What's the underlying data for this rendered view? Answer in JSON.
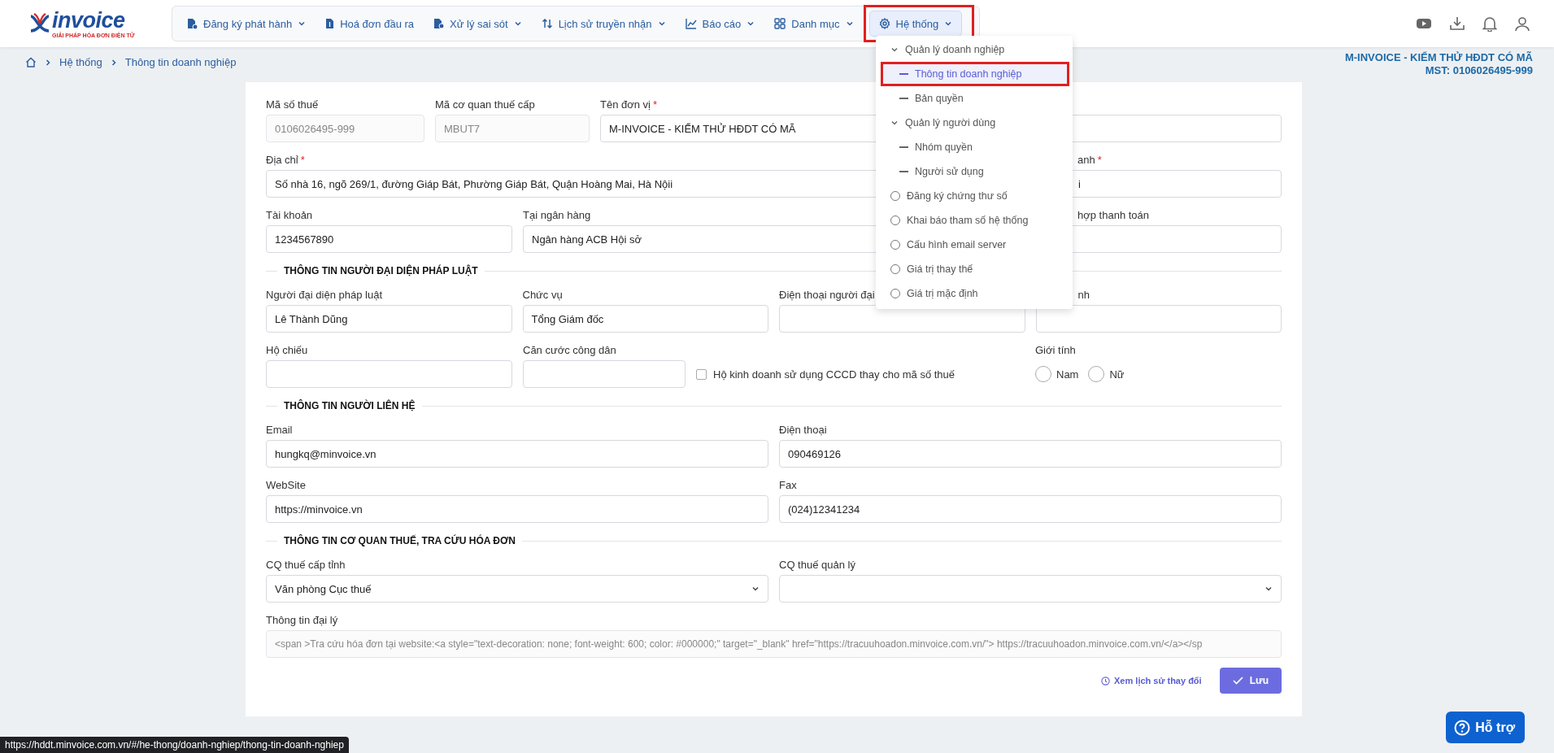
{
  "logo": {
    "text": "invoice",
    "tagline": "GIẢI PHÁP HÓA ĐƠN ĐIỆN TỬ"
  },
  "nav": {
    "items": [
      {
        "label": "Đăng ký phát hành",
        "caret": true,
        "selected": false,
        "outlined": false
      },
      {
        "label": "Hoá đơn đầu ra",
        "caret": false,
        "selected": false,
        "outlined": false
      },
      {
        "label": "Xử lý sai sót",
        "caret": true,
        "selected": false,
        "outlined": false
      },
      {
        "label": "Lịch sử truyền nhận",
        "caret": true,
        "selected": false,
        "outlined": false
      },
      {
        "label": "Báo cáo",
        "caret": true,
        "selected": false,
        "outlined": false
      },
      {
        "label": "Danh mục",
        "caret": true,
        "selected": false,
        "outlined": false
      },
      {
        "label": "Hệ thống",
        "caret": true,
        "selected": true,
        "outlined": true
      }
    ]
  },
  "breadcrumb": [
    "Hệ thống",
    "Thông tin doanh nghiệp"
  ],
  "company": {
    "name": "M-INVOICE - KIỂM THỬ HĐDT CÓ MÃ",
    "tax_code": "MST: 0106026495-999"
  },
  "system_menu": {
    "items": [
      {
        "kind": "group",
        "label": "Quản lý doanh nghiệp",
        "expanded": true,
        "children": [
          {
            "kind": "leaf",
            "label": "Thông tin doanh nghiệp",
            "selected": true,
            "outlined": true
          },
          {
            "kind": "leaf",
            "label": "Bản quyền",
            "selected": false,
            "outlined": false
          }
        ]
      },
      {
        "kind": "group",
        "label": "Quản lý người dùng",
        "expanded": true,
        "children": [
          {
            "kind": "leaf",
            "label": "Nhóm quyền",
            "selected": false,
            "outlined": false
          },
          {
            "kind": "leaf",
            "label": "Người sử dụng",
            "selected": false,
            "outlined": false
          }
        ]
      },
      {
        "kind": "page",
        "label": "Đăng ký chứng thư số",
        "selected": false,
        "outlined": false
      },
      {
        "kind": "page",
        "label": "Khai báo tham số hệ thống",
        "selected": false,
        "outlined": false
      },
      {
        "kind": "page",
        "label": "Cấu hình email server",
        "selected": false,
        "outlined": false
      },
      {
        "kind": "page",
        "label": "Giá trị thay thế",
        "selected": false,
        "outlined": false
      },
      {
        "kind": "page",
        "label": "Giá trị mặc định",
        "selected": false,
        "outlined": false
      }
    ]
  },
  "form": {
    "rows": [
      {
        "kind": "fields",
        "fields": [
          {
            "kind": "text",
            "label": "Mã số thuế",
            "value": "0106026495-999",
            "disabled": true
          },
          {
            "kind": "text",
            "label": "Mã cơ quan thuế cấp",
            "value": "MBUT7",
            "disabled": true
          },
          {
            "kind": "text",
            "label": "Tên đơn vị",
            "required_mark": "*",
            "value": "M-INVOICE - KIỂM THỬ HĐDT CÓ MÃ",
            "disabled": false
          },
          {
            "kind": "text",
            "disabled": false
          }
        ]
      },
      {
        "kind": "fields",
        "fields": [
          {
            "kind": "text",
            "label": "Địa chỉ",
            "required_mark": "*",
            "value": "Số nhà 16, ngõ 269/1, đường Giáp Bát, Phường Giáp Bát, Quận Hoàng Mai, Hà Nộii",
            "disabled": false
          },
          {
            "kind": "text",
            "label": "anh",
            "required_mark": "*",
            "value": "i",
            "disabled": false
          }
        ]
      },
      {
        "kind": "fields",
        "fields": [
          {
            "kind": "text",
            "label": "Tài khoản",
            "value": "1234567890",
            "disabled": false
          },
          {
            "kind": "text",
            "label": "Tại ngân hàng",
            "value": "Ngân hàng ACB Hội sở",
            "disabled": false
          },
          {
            "kind": "text",
            "label": "hợp thanh toán",
            "disabled": false
          }
        ]
      },
      {
        "kind": "section",
        "title": "THÔNG TIN NGƯỜI ĐẠI DIỆN PHÁP LUẬT"
      },
      {
        "kind": "fields",
        "fields": [
          {
            "kind": "text",
            "label": "Người đại diện pháp luật",
            "value": "Lê Thành Dũng",
            "disabled": false
          },
          {
            "kind": "text",
            "label": "Chức vụ",
            "value": "Tổng Giám đốc",
            "disabled": false
          },
          {
            "kind": "text",
            "label": "Điện thoại người đại",
            "disabled": false
          },
          {
            "kind": "text",
            "label": "nh",
            "disabled": false
          }
        ]
      },
      {
        "kind": "fields",
        "fields": [
          {
            "kind": "text",
            "label": "Hộ chiếu",
            "disabled": false
          },
          {
            "kind": "text",
            "label": "Căn cước công dân",
            "disabled": false
          },
          {
            "kind": "checkbox",
            "label": "Hộ kinh doanh sử dụng CCCD thay cho mã số thuế",
            "checked": false
          },
          {
            "kind": "radio",
            "label": "Giới tính",
            "options": [
              {
                "label": "Nam",
                "selected": false
              },
              {
                "label": "Nữ",
                "selected": false
              }
            ]
          }
        ]
      },
      {
        "kind": "section",
        "title": "THÔNG TIN NGƯỜI LIÊN HỆ"
      },
      {
        "kind": "fields",
        "fields": [
          {
            "kind": "text",
            "label": "Email",
            "value": "hungkq@minvoice.vn",
            "disabled": false
          },
          {
            "kind": "text",
            "label": "Điện thoại",
            "value": "090469126",
            "disabled": false
          }
        ]
      },
      {
        "kind": "fields",
        "fields": [
          {
            "kind": "text",
            "label": "WebSite",
            "value": "https://minvoice.vn",
            "disabled": false
          },
          {
            "kind": "text",
            "label": "Fax",
            "value": "(024)12341234",
            "disabled": false
          }
        ]
      },
      {
        "kind": "section",
        "title": "THÔNG TIN CƠ QUAN THUẾ, TRA CỨU HÓA ĐƠN"
      },
      {
        "kind": "fields",
        "fields": [
          {
            "kind": "select",
            "label": "CQ thuế cấp tỉnh",
            "value": "Văn phòng Cục thuế",
            "disabled": false
          },
          {
            "kind": "select",
            "label": "CQ thuế quản lý",
            "disabled": false
          }
        ]
      },
      {
        "kind": "fields",
        "fields": [
          {
            "kind": "text",
            "label": "Thông tin đại lý",
            "value": "<span >Tra cứu hóa đơn tại website:<a style=\"text-decoration: none; font-weight: 600; color: #000000;\" target=\"_blank\" href=\"https://tracuuhoadon.minvoice.com.vn/\"> https://tracuuhoadon.minvoice.com.vn/</a></sp",
            "disabled": true
          }
        ]
      }
    ],
    "history_link": "Xem lịch sử thay đổi",
    "save_button": "Lưu"
  },
  "status_url": "https://hddt.minvoice.com.vn/#/he-thong/doanh-nghiep/thong-tin-doanh-nghiep",
  "help_button": "Hỗ trợ"
}
